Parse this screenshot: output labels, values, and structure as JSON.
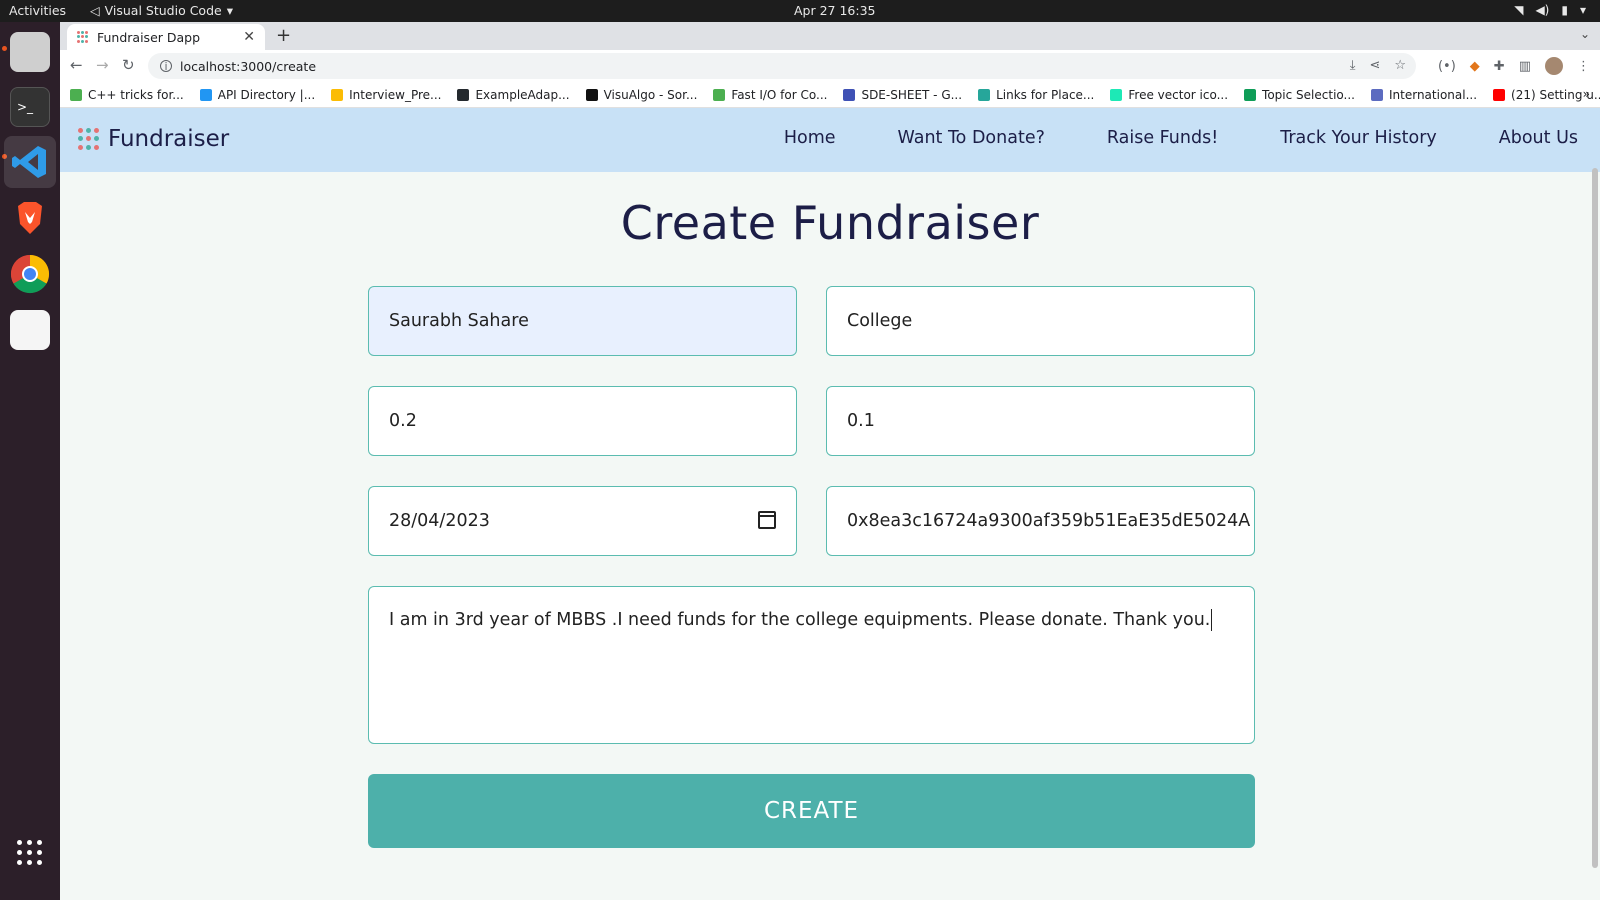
{
  "os": {
    "activities": "Activities",
    "app_name": "Visual Studio Code",
    "clock": "Apr 27  16:35"
  },
  "browser": {
    "tab_title": "Fundraiser Dapp",
    "url": "localhost:3000/create",
    "bookmarks": [
      {
        "label": "C++ tricks for...",
        "color": "#4caf50"
      },
      {
        "label": "API Directory |...",
        "color": "#2196f3"
      },
      {
        "label": "Interview_Pre...",
        "color": "#fbbc04"
      },
      {
        "label": "ExampleAdap...",
        "color": "#24292e"
      },
      {
        "label": "VisuAlgo - Sor...",
        "color": "#111111"
      },
      {
        "label": "Fast I/O for Co...",
        "color": "#4caf50"
      },
      {
        "label": "SDE-SHEET - G...",
        "color": "#3f51b5"
      },
      {
        "label": "Links for Place...",
        "color": "#26a69a"
      },
      {
        "label": "Free vector ico...",
        "color": "#1de9b6"
      },
      {
        "label": "Topic Selectio...",
        "color": "#0f9d58"
      },
      {
        "label": "International...",
        "color": "#5c6bc0"
      },
      {
        "label": "(21) Setting u...",
        "color": "#ff0000"
      }
    ]
  },
  "site": {
    "brand": "Fundraiser",
    "nav": [
      "Home",
      "Want To Donate?",
      "Raise Funds!",
      "Track Your History",
      "About Us"
    ],
    "heading": "Create Fundraiser",
    "form": {
      "name": "Saurabh Sahare",
      "category": "College",
      "target_amount": "0.2",
      "min_contribution": "0.1",
      "deadline": "28/04/2023",
      "wallet_address": "0x8ea3c16724a9300af359b51EaE35dE5024A",
      "description": "I am in 3rd year of MBBS .I need funds for the college equipments. Please donate. Thank you."
    },
    "submit_label": "CREATE"
  },
  "colors": {
    "accent": "#4db0aa",
    "navbar": "#c8e1f6",
    "brand_text": "#1c1e47"
  }
}
